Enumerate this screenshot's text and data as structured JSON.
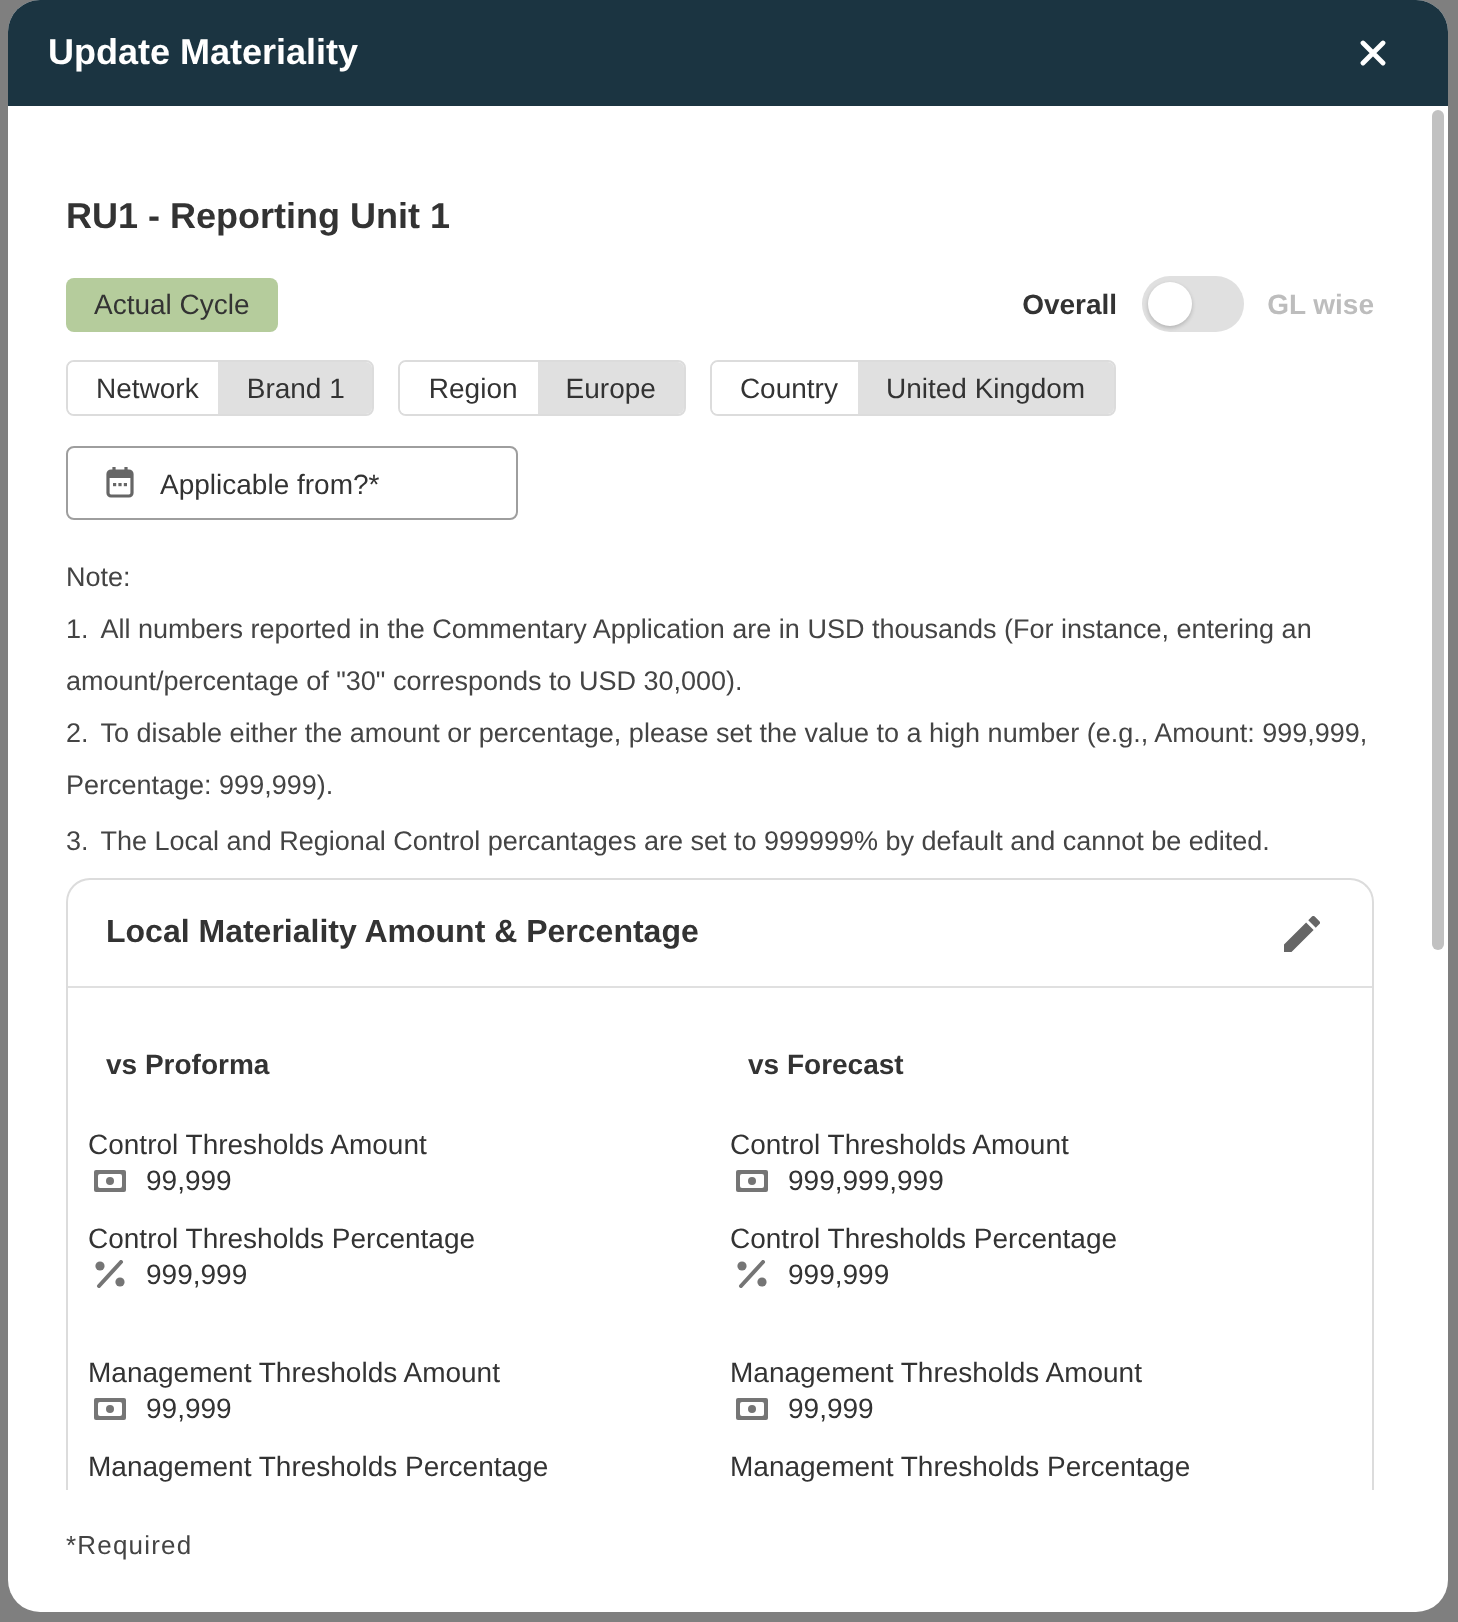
{
  "dialog": {
    "title": "Update Materiality"
  },
  "unit_title": "RU1 - Reporting Unit 1",
  "cycle_badge": "Actual Cycle",
  "view_toggle": {
    "left_label": "Overall",
    "right_label": "GL wise",
    "on": false
  },
  "filters": [
    {
      "label": "Network",
      "value": "Brand 1"
    },
    {
      "label": "Region",
      "value": "Europe"
    },
    {
      "label": "Country",
      "value": "United Kingdom"
    }
  ],
  "date_field": {
    "placeholder": "Applicable from?*"
  },
  "note": {
    "heading": "Note:",
    "items": [
      {
        "number": "1.",
        "text": "All numbers reported in the Commentary Application are in USD thousands (For instance, entering an amount/percentage of \"30\" corresponds to USD 30,000)."
      },
      {
        "number": "2.",
        "text": "To disable either the amount or percentage, please set the value to a high number (e.g., Amount: 999,999, Percentage: 999,999)."
      },
      {
        "number": "3.",
        "text": "The Local and Regional Control percantages are set to 999999% by default and cannot be edited."
      }
    ]
  },
  "materiality_card": {
    "title": "Local Materiality Amount & Percentage",
    "columns": [
      {
        "heading": "vs Proforma",
        "sections": [
          {
            "fields": [
              {
                "label": "Control Thresholds Amount",
                "kind": "amount",
                "value": "99,999"
              },
              {
                "label": "Control Thresholds Percentage",
                "kind": "percentage",
                "value": "999,999"
              }
            ]
          },
          {
            "fields": [
              {
                "label": "Management Thresholds Amount",
                "kind": "amount",
                "value": "99,999"
              },
              {
                "label": "Management Thresholds Percentage"
              }
            ]
          }
        ]
      },
      {
        "heading": "vs Forecast",
        "sections": [
          {
            "fields": [
              {
                "label": "Control Thresholds Amount",
                "kind": "amount",
                "value": "999,999,999"
              },
              {
                "label": "Control Thresholds Percentage",
                "kind": "percentage",
                "value": "999,999"
              }
            ]
          },
          {
            "fields": [
              {
                "label": "Management Thresholds Amount",
                "kind": "amount",
                "value": "99,999"
              },
              {
                "label": "Management Thresholds Percentage"
              }
            ]
          }
        ]
      }
    ]
  },
  "footer": {
    "note": "*Required"
  }
}
